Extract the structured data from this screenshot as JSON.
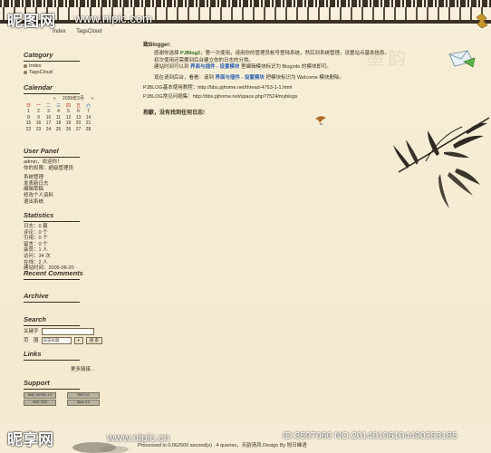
{
  "header": {
    "logo_text": "昵图网",
    "logo_url": "www.nipic.com",
    "nav": [
      "Index",
      "TagsCloud"
    ]
  },
  "sidebar": {
    "category": {
      "title": "Category",
      "items": [
        "Index",
        "TagsCloud"
      ]
    },
    "calendar": {
      "title": "Calendar",
      "prev": "«",
      "month_label": "2009年2月",
      "next": "»",
      "weekdays": [
        "日",
        "一",
        "二",
        "三",
        "四",
        "五",
        "六"
      ],
      "weeks": [
        [
          "1",
          "2",
          "3",
          "4",
          "5",
          "6",
          "7"
        ],
        [
          "8",
          "9",
          "10",
          "11",
          "12",
          "13",
          "14"
        ],
        [
          "15",
          "16",
          "17",
          "18",
          "19",
          "20",
          "21"
        ],
        [
          "22",
          "23",
          "24",
          "25",
          "26",
          "27",
          "28"
        ]
      ]
    },
    "user_panel": {
      "title": "User Panel",
      "welcome_line": "admin，欢迎你！",
      "role_line": "你的权限：超级管理员",
      "links": [
        "系统管理",
        "发表新日志",
        "编辑草稿",
        "修改个人资料",
        "退出系统"
      ]
    },
    "statistics": {
      "title": "Statistics",
      "lines": [
        "日志：0 篇",
        "评论：0 个",
        "引用：0 个",
        "留言：0 个",
        "会员：1 人",
        "访问：34 次",
        "在线：2 人",
        "建站时间：2005-06-20"
      ]
    },
    "recent_comments": {
      "title": "Recent Comments"
    },
    "archive": {
      "title": "Archive"
    },
    "search": {
      "title": "Search",
      "keyword_label": "关键字",
      "scope_label": "范　围",
      "scope_value": "日志标题",
      "submit_label": "搜 索"
    },
    "links": {
      "title": "Links",
      "more": "更多链接..."
    },
    "support": {
      "title": "Support",
      "badges": [
        "W3C XHTML 1.0",
        "W3C CSS",
        "RSS 2.0",
        "Atom 1.0"
      ]
    }
  },
  "main": {
    "greeting": "致Blogger:",
    "lines": [
      {
        "pre": "感谢你选择 ",
        "hl": "PJBlog2",
        "post": "，第一次使用，请用你的管理员帐号登陆系统，然后到系统管理，设置站点基本信息。"
      },
      {
        "pre": "初次使用还需要到后台建立你的日志的分类。",
        "hl": "",
        "post": ""
      },
      {
        "pre": "建站时间可以到 ",
        "hl": "界面与插件 - 设置模块",
        "post": " 里编辑模块标识为 Bloginfo 的模块即可。"
      },
      {
        "pre": "现在请到后台，看看：请到 ",
        "hl": "界面与插件 - 设置模块",
        "post": " 把模块标识为 Welcome 模块删除。"
      },
      {
        "pre": "PJBLOG基本使用教程：http://bbs.pjhome.net/thread-4753-1-1.html",
        "hl": "",
        "post": ""
      },
      {
        "pre": "PJBLOG常见问题集：http://bbs.pjhome.net/space.php?7524/myblogs",
        "hl": "",
        "post": ""
      }
    ],
    "empty_notice": "抱歉，没有找到任何日志!"
  },
  "footer": {
    "processed": "Processed in 0.062500 second(s) , 4 queries",
    "suffix": "，天韵清风 Design By 旭日峰语"
  },
  "watermark": {
    "brand": "昵享网",
    "url": "www.nipic.cn",
    "id_text": "ID:3597066 NO:20140106104490253185"
  },
  "colors": {
    "background": "#f6eed6",
    "accent_green": "#2a6a1a",
    "accent_blue": "#2b5fb0",
    "ink": "#3b3025"
  }
}
